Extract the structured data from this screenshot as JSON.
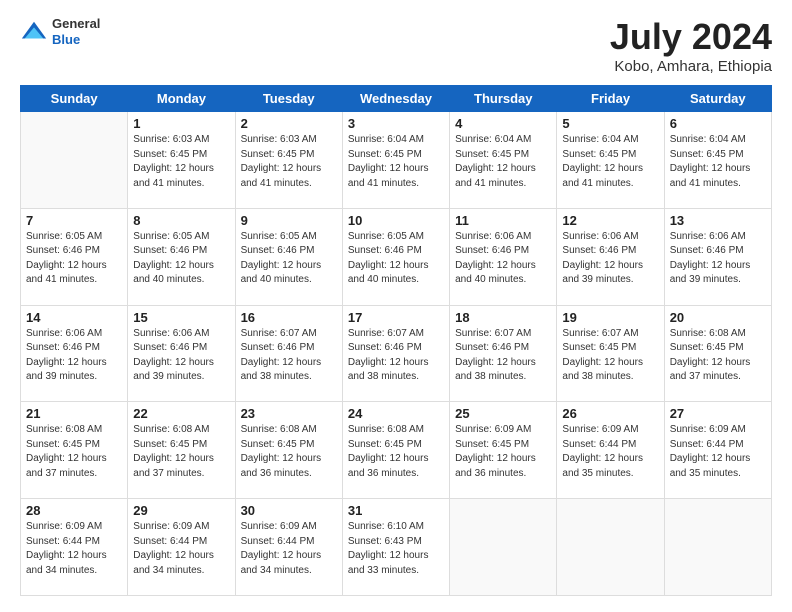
{
  "logo": {
    "general": "General",
    "blue": "Blue"
  },
  "title": "July 2024",
  "subtitle": "Kobo, Amhara, Ethiopia",
  "days_of_week": [
    "Sunday",
    "Monday",
    "Tuesday",
    "Wednesday",
    "Thursday",
    "Friday",
    "Saturday"
  ],
  "weeks": [
    [
      {
        "day": "",
        "sunrise": "",
        "sunset": "",
        "daylight": ""
      },
      {
        "day": "1",
        "sunrise": "Sunrise: 6:03 AM",
        "sunset": "Sunset: 6:45 PM",
        "daylight": "Daylight: 12 hours and 41 minutes."
      },
      {
        "day": "2",
        "sunrise": "Sunrise: 6:03 AM",
        "sunset": "Sunset: 6:45 PM",
        "daylight": "Daylight: 12 hours and 41 minutes."
      },
      {
        "day": "3",
        "sunrise": "Sunrise: 6:04 AM",
        "sunset": "Sunset: 6:45 PM",
        "daylight": "Daylight: 12 hours and 41 minutes."
      },
      {
        "day": "4",
        "sunrise": "Sunrise: 6:04 AM",
        "sunset": "Sunset: 6:45 PM",
        "daylight": "Daylight: 12 hours and 41 minutes."
      },
      {
        "day": "5",
        "sunrise": "Sunrise: 6:04 AM",
        "sunset": "Sunset: 6:45 PM",
        "daylight": "Daylight: 12 hours and 41 minutes."
      },
      {
        "day": "6",
        "sunrise": "Sunrise: 6:04 AM",
        "sunset": "Sunset: 6:45 PM",
        "daylight": "Daylight: 12 hours and 41 minutes."
      }
    ],
    [
      {
        "day": "7",
        "sunrise": "Sunrise: 6:05 AM",
        "sunset": "Sunset: 6:46 PM",
        "daylight": "Daylight: 12 hours and 41 minutes."
      },
      {
        "day": "8",
        "sunrise": "Sunrise: 6:05 AM",
        "sunset": "Sunset: 6:46 PM",
        "daylight": "Daylight: 12 hours and 40 minutes."
      },
      {
        "day": "9",
        "sunrise": "Sunrise: 6:05 AM",
        "sunset": "Sunset: 6:46 PM",
        "daylight": "Daylight: 12 hours and 40 minutes."
      },
      {
        "day": "10",
        "sunrise": "Sunrise: 6:05 AM",
        "sunset": "Sunset: 6:46 PM",
        "daylight": "Daylight: 12 hours and 40 minutes."
      },
      {
        "day": "11",
        "sunrise": "Sunrise: 6:06 AM",
        "sunset": "Sunset: 6:46 PM",
        "daylight": "Daylight: 12 hours and 40 minutes."
      },
      {
        "day": "12",
        "sunrise": "Sunrise: 6:06 AM",
        "sunset": "Sunset: 6:46 PM",
        "daylight": "Daylight: 12 hours and 39 minutes."
      },
      {
        "day": "13",
        "sunrise": "Sunrise: 6:06 AM",
        "sunset": "Sunset: 6:46 PM",
        "daylight": "Daylight: 12 hours and 39 minutes."
      }
    ],
    [
      {
        "day": "14",
        "sunrise": "Sunrise: 6:06 AM",
        "sunset": "Sunset: 6:46 PM",
        "daylight": "Daylight: 12 hours and 39 minutes."
      },
      {
        "day": "15",
        "sunrise": "Sunrise: 6:06 AM",
        "sunset": "Sunset: 6:46 PM",
        "daylight": "Daylight: 12 hours and 39 minutes."
      },
      {
        "day": "16",
        "sunrise": "Sunrise: 6:07 AM",
        "sunset": "Sunset: 6:46 PM",
        "daylight": "Daylight: 12 hours and 38 minutes."
      },
      {
        "day": "17",
        "sunrise": "Sunrise: 6:07 AM",
        "sunset": "Sunset: 6:46 PM",
        "daylight": "Daylight: 12 hours and 38 minutes."
      },
      {
        "day": "18",
        "sunrise": "Sunrise: 6:07 AM",
        "sunset": "Sunset: 6:46 PM",
        "daylight": "Daylight: 12 hours and 38 minutes."
      },
      {
        "day": "19",
        "sunrise": "Sunrise: 6:07 AM",
        "sunset": "Sunset: 6:45 PM",
        "daylight": "Daylight: 12 hours and 38 minutes."
      },
      {
        "day": "20",
        "sunrise": "Sunrise: 6:08 AM",
        "sunset": "Sunset: 6:45 PM",
        "daylight": "Daylight: 12 hours and 37 minutes."
      }
    ],
    [
      {
        "day": "21",
        "sunrise": "Sunrise: 6:08 AM",
        "sunset": "Sunset: 6:45 PM",
        "daylight": "Daylight: 12 hours and 37 minutes."
      },
      {
        "day": "22",
        "sunrise": "Sunrise: 6:08 AM",
        "sunset": "Sunset: 6:45 PM",
        "daylight": "Daylight: 12 hours and 37 minutes."
      },
      {
        "day": "23",
        "sunrise": "Sunrise: 6:08 AM",
        "sunset": "Sunset: 6:45 PM",
        "daylight": "Daylight: 12 hours and 36 minutes."
      },
      {
        "day": "24",
        "sunrise": "Sunrise: 6:08 AM",
        "sunset": "Sunset: 6:45 PM",
        "daylight": "Daylight: 12 hours and 36 minutes."
      },
      {
        "day": "25",
        "sunrise": "Sunrise: 6:09 AM",
        "sunset": "Sunset: 6:45 PM",
        "daylight": "Daylight: 12 hours and 36 minutes."
      },
      {
        "day": "26",
        "sunrise": "Sunrise: 6:09 AM",
        "sunset": "Sunset: 6:44 PM",
        "daylight": "Daylight: 12 hours and 35 minutes."
      },
      {
        "day": "27",
        "sunrise": "Sunrise: 6:09 AM",
        "sunset": "Sunset: 6:44 PM",
        "daylight": "Daylight: 12 hours and 35 minutes."
      }
    ],
    [
      {
        "day": "28",
        "sunrise": "Sunrise: 6:09 AM",
        "sunset": "Sunset: 6:44 PM",
        "daylight": "Daylight: 12 hours and 34 minutes."
      },
      {
        "day": "29",
        "sunrise": "Sunrise: 6:09 AM",
        "sunset": "Sunset: 6:44 PM",
        "daylight": "Daylight: 12 hours and 34 minutes."
      },
      {
        "day": "30",
        "sunrise": "Sunrise: 6:09 AM",
        "sunset": "Sunset: 6:44 PM",
        "daylight": "Daylight: 12 hours and 34 minutes."
      },
      {
        "day": "31",
        "sunrise": "Sunrise: 6:10 AM",
        "sunset": "Sunset: 6:43 PM",
        "daylight": "Daylight: 12 hours and 33 minutes."
      },
      {
        "day": "",
        "sunrise": "",
        "sunset": "",
        "daylight": ""
      },
      {
        "day": "",
        "sunrise": "",
        "sunset": "",
        "daylight": ""
      },
      {
        "day": "",
        "sunrise": "",
        "sunset": "",
        "daylight": ""
      }
    ]
  ]
}
